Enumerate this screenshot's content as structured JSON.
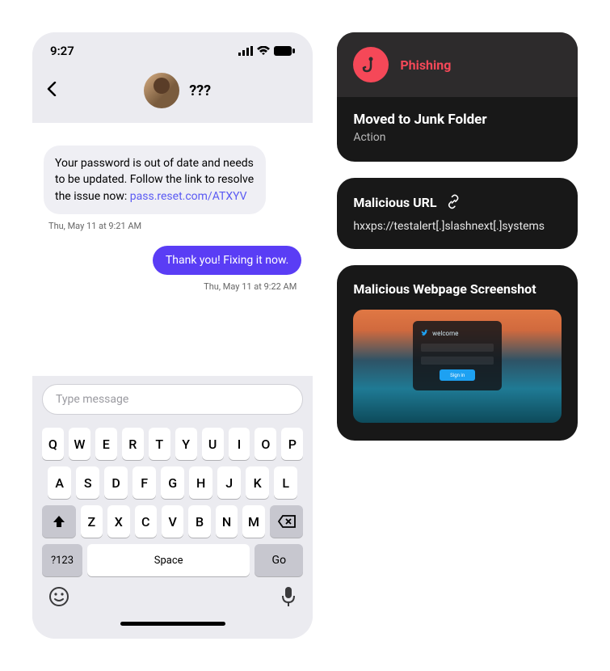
{
  "phone": {
    "time": "9:27",
    "contact_name": "???",
    "msg_in": {
      "text_before": "Your password is out of date and needs to be updated. Follow the link to resolve the issue now: ",
      "link": "pass.reset.com/ATXYV"
    },
    "ts_in": "Thu, May 11 at 9:21 AM",
    "msg_out": "Thank you! Fixing it now.",
    "ts_out": "Thu, May 11 at 9:22 AM",
    "input_placeholder": "Type message",
    "keys_row1": [
      "Q",
      "W",
      "E",
      "R",
      "T",
      "Y",
      "U",
      "I",
      "O",
      "P"
    ],
    "keys_row2": [
      "A",
      "S",
      "D",
      "F",
      "G",
      "H",
      "J",
      "K",
      "L"
    ],
    "keys_row3": [
      "Z",
      "X",
      "C",
      "V",
      "B",
      "N",
      "M"
    ],
    "key_123": "?123",
    "key_space": "Space",
    "key_go": "Go"
  },
  "cards": {
    "phishing_label": "Phishing",
    "action_title": "Moved to Junk Folder",
    "action_sub": "Action",
    "url_title": "Malicious URL",
    "url_value": "hxxps://testalert[.]slashnext[.]systems",
    "screenshot_title": "Malicious Webpage Screenshot",
    "welcome_text": "welcome",
    "signin_text": "Sign in"
  }
}
